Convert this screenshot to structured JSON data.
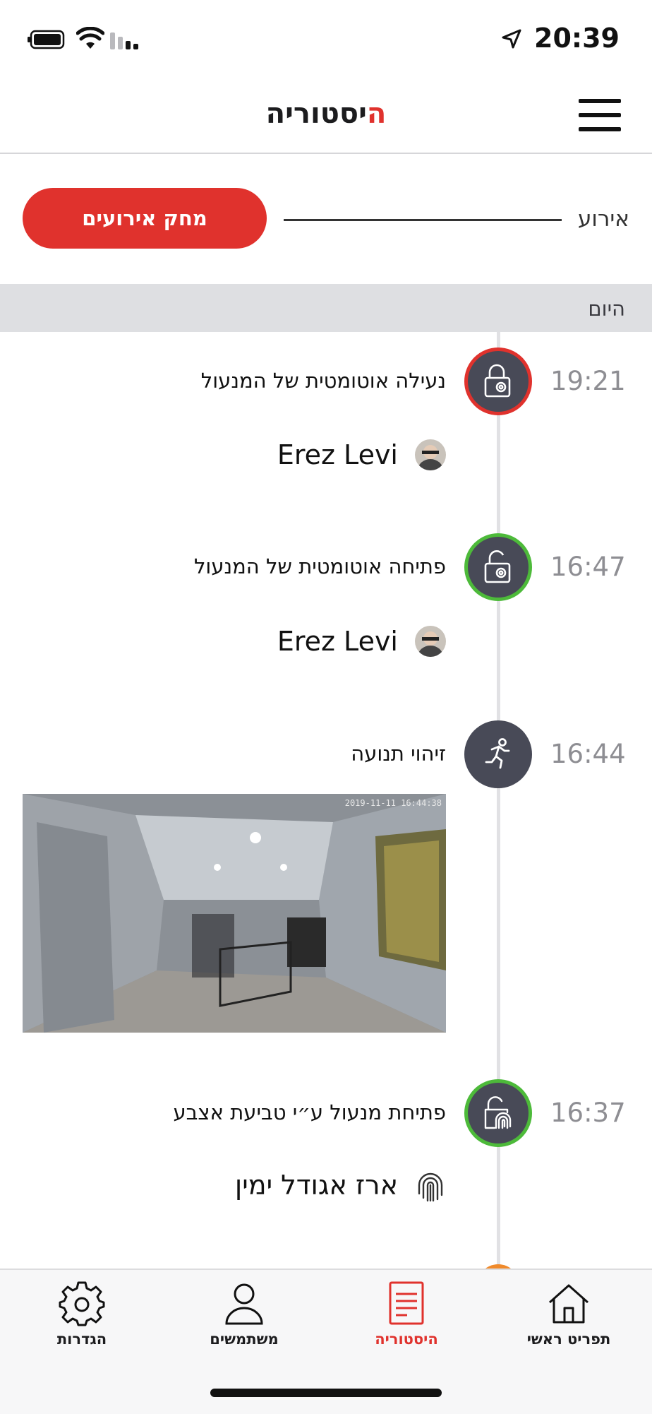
{
  "status_bar": {
    "time": "20:39"
  },
  "header": {
    "title_accent": "ה",
    "title_rest": "יסטוריה"
  },
  "filter": {
    "label": "אירוע",
    "clear_label": "מחק אירועים"
  },
  "day_header": {
    "label": "היום"
  },
  "events": [
    {
      "time": "19:21",
      "title": "נעילה אוטומטית של המנעול",
      "user": "Erez Levi",
      "status": "locked",
      "icon": "lock-camera-icon",
      "ring_color": "#e0322d"
    },
    {
      "time": "16:47",
      "title": "פתיחה אוטומטית של המנעול",
      "user": "Erez Levi",
      "status": "unlocked",
      "icon": "unlock-camera-icon",
      "ring_color": "#4dba3a"
    },
    {
      "time": "16:44",
      "title": "זיהוי תנועה",
      "snapshot_timestamp": "2019-11-11 16:44:38",
      "icon": "motion-icon"
    },
    {
      "time": "16:37",
      "title": "פתיחת מנעול ע״י טביעת אצבע",
      "user": "ארז אגודל ימין",
      "status": "unlocked",
      "icon": "fingerprint-lock-icon",
      "ring_color": "#4dba3a"
    }
  ],
  "tabs": [
    {
      "label": "תפריט ראשי",
      "icon": "home-icon",
      "active": false
    },
    {
      "label": "היסטוריה",
      "icon": "history-icon",
      "active": true
    },
    {
      "label": "משתמשים",
      "icon": "user-icon",
      "active": false
    },
    {
      "label": "הגדרות",
      "icon": "gear-icon",
      "active": false
    }
  ],
  "colors": {
    "accent": "#e0322d",
    "success": "#4dba3a",
    "icon_bg": "#484a57"
  }
}
